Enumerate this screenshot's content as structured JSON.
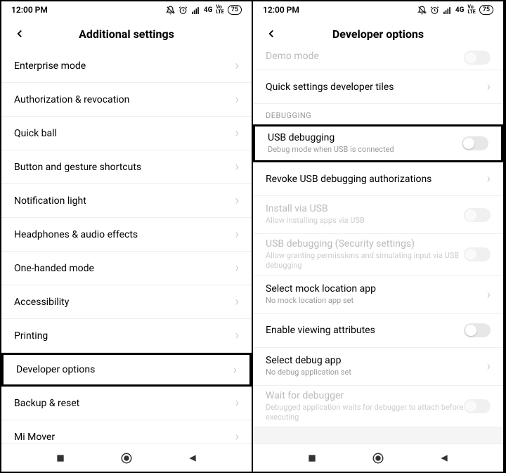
{
  "status": {
    "time": "12:00 PM",
    "network": "4G",
    "lte": "Vo LTE",
    "battery": "75"
  },
  "left": {
    "title": "Additional settings",
    "items": [
      {
        "label": "Enterprise mode",
        "type": "nav"
      },
      {
        "label": "Authorization & revocation",
        "type": "nav",
        "gapBefore": true
      },
      {
        "label": "Quick ball",
        "type": "nav",
        "gapBefore": true
      },
      {
        "label": "Button and gesture shortcuts",
        "type": "nav"
      },
      {
        "label": "Notification light",
        "type": "nav"
      },
      {
        "label": "Headphones & audio effects",
        "type": "nav"
      },
      {
        "label": "One-handed mode",
        "type": "nav"
      },
      {
        "label": "Accessibility",
        "type": "nav"
      },
      {
        "label": "Printing",
        "type": "nav"
      },
      {
        "label": "Developer options",
        "type": "nav",
        "highlight": true,
        "gapBefore": true
      },
      {
        "label": "Backup & reset",
        "type": "nav",
        "gapBefore": true
      },
      {
        "label": "Mi Mover",
        "type": "nav"
      }
    ]
  },
  "right": {
    "title": "Developer options",
    "partialTop": {
      "label": "Demo mode",
      "type": "toggle",
      "disabled": true
    },
    "sectionHeader": "DEBUGGING",
    "preItems": [
      {
        "label": "Quick settings developer tiles",
        "type": "nav"
      }
    ],
    "items": [
      {
        "label": "USB debugging",
        "sub": "Debug mode when USB is connected",
        "type": "toggle",
        "highlight": true
      },
      {
        "label": "Revoke USB debugging authorizations",
        "type": "nav"
      },
      {
        "label": "Install via USB",
        "sub": "Allow installing apps via USB",
        "type": "toggle",
        "disabled": true
      },
      {
        "label": "USB debugging (Security settings)",
        "sub": "Allow granting permissions and simulating input via USB debugging",
        "type": "toggle",
        "disabled": true
      },
      {
        "label": "Select mock location app",
        "sub": "No mock location app set",
        "type": "nav"
      },
      {
        "label": "Enable viewing attributes",
        "type": "toggle"
      },
      {
        "label": "Select debug app",
        "sub": "No debug application set",
        "type": "nav"
      },
      {
        "label": "Wait for debugger",
        "sub": "Debugged application waits for debugger to attach before executing",
        "type": "toggle",
        "disabled": true
      }
    ]
  }
}
